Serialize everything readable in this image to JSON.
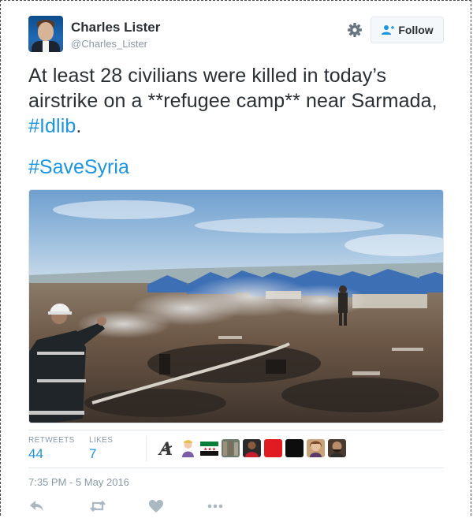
{
  "author": {
    "name": "Charles Lister",
    "handle": "@Charles_Lister"
  },
  "follow_button": {
    "label": "Follow",
    "icon": "add-user-icon"
  },
  "settings_icon": "gear-icon",
  "tweet": {
    "text": "At least 28 civilians were killed in today’s airstrike on a **refugee camp** near Sarmada, ",
    "hashtag_inline": "#Idlib",
    "after_hashtag": ".",
    "hashtag_line": "#SaveSyria"
  },
  "stats": {
    "retweets_label": "RETWEETS",
    "retweets_value": "44",
    "likes_label": "LIKES",
    "likes_value": "7"
  },
  "likers": [
    "avatar-1",
    "avatar-2",
    "avatar-3",
    "avatar-4",
    "avatar-5",
    "avatar-6",
    "avatar-7",
    "avatar-8",
    "avatar-9"
  ],
  "timestamp": "7:35 PM - 5 May 2016",
  "actions": [
    "reply-icon",
    "retweet-icon",
    "like-icon",
    "more-icon"
  ],
  "colors": {
    "link": "#1b95e0",
    "text": "#292f33",
    "muted": "#8899a6",
    "border": "#e1e8ed",
    "action_icon": "#aab8c2"
  }
}
